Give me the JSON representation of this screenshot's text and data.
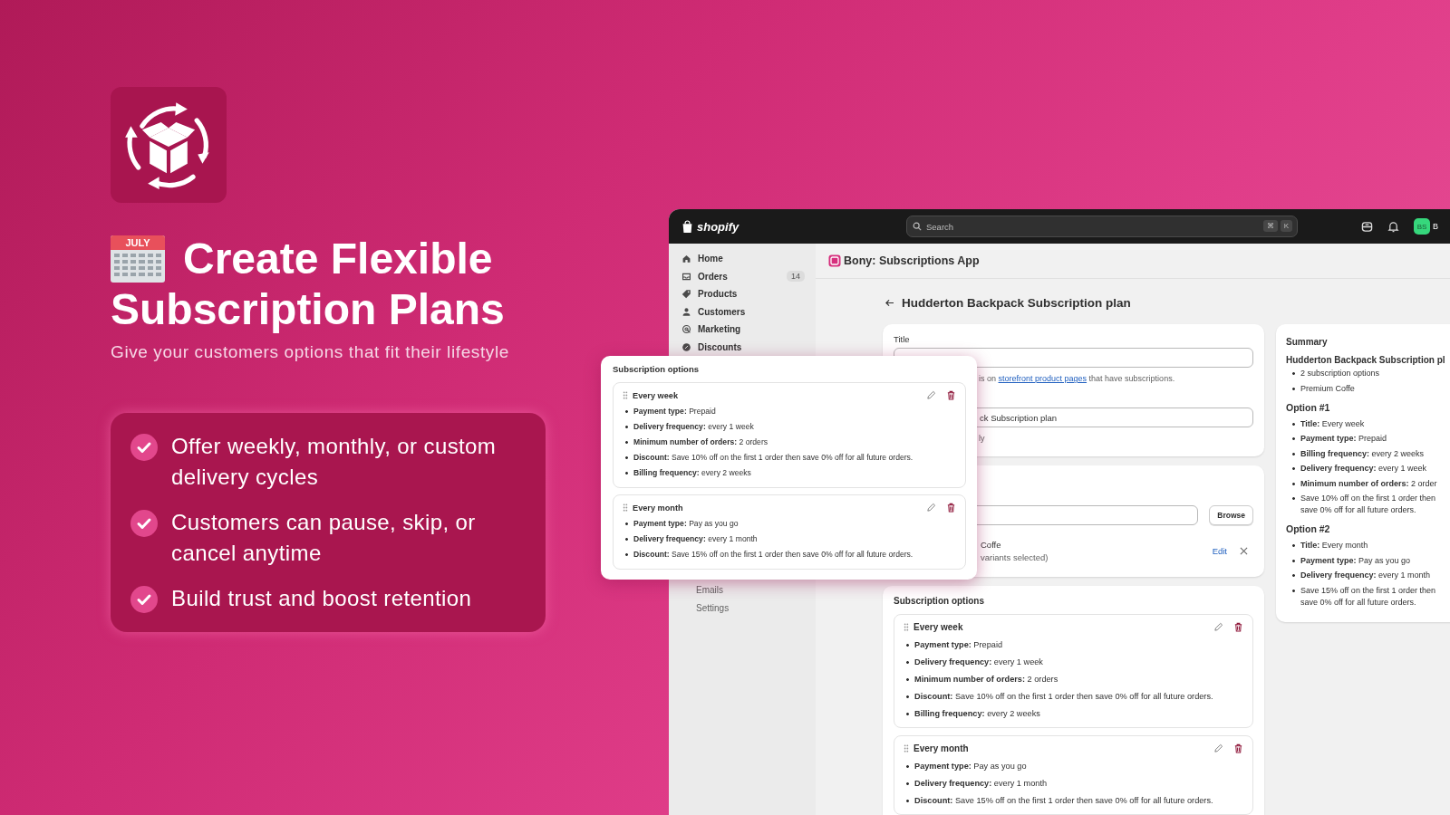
{
  "promo": {
    "calendar_label": "JULY",
    "heading_lines": [
      "Create Flexible",
      "Subscription Plans"
    ],
    "subtitle": "Give your customers options that fit their lifestyle",
    "features": [
      "Offer weekly, monthly, or custom delivery cycles",
      "Customers can pause, skip, or cancel anytime",
      "Build trust and boost retention"
    ]
  },
  "admin": {
    "brand": "shopify",
    "search": {
      "placeholder": "Search",
      "shortcut": [
        "⌘",
        "K"
      ]
    },
    "avatar": "BS",
    "user_name": "B",
    "sidebar": {
      "items": [
        {
          "label": "Home",
          "selected": false
        },
        {
          "label": "Orders",
          "badge": "14",
          "selected": false
        },
        {
          "label": "Products",
          "selected": false
        },
        {
          "label": "Customers",
          "selected": false
        },
        {
          "label": "Marketing",
          "selected": false
        },
        {
          "label": "Discounts",
          "selected": false
        }
      ],
      "lower_items": [
        {
          "label": "Emails",
          "selected": false
        },
        {
          "label": "Settings",
          "selected": false
        }
      ]
    },
    "app_title": "Bony: Subscriptions App",
    "page_title": "Hudderton Backpack Subscription plan",
    "title_card": {
      "label": "Title",
      "hint_before": "is on ",
      "hint_link": "storefront product pages",
      "hint_after": " that have subscriptions.",
      "name_value": "ck Subscription plan",
      "name_hint": "ly"
    },
    "product_card": {
      "browse": "Browse",
      "product_name": "Coffe",
      "product_detail": "variants selected)",
      "edit": "Edit"
    },
    "options_card": {
      "heading": "Subscription options",
      "options": [
        {
          "title": "Every week",
          "details": [
            "**Payment type:** Prepaid",
            "**Delivery frequency:** every 1 week",
            "**Minimum number of orders:** 2 orders",
            "**Discount:** Save 10% off on the first 1 order then save 0% off for all future orders.",
            "**Billing frequency:** every 2 weeks"
          ]
        },
        {
          "title": "Every month",
          "details": [
            "**Payment type:** Pay as you go",
            "**Delivery frequency:** every 1 month",
            "**Discount:** Save 15% off on the first 1 order then save 0% off for all future orders."
          ]
        }
      ]
    },
    "summary": {
      "heading": "Summary",
      "plan_name": "Hudderton Backpack Subscription pl",
      "overview": [
        "2 subscription options",
        "Premium Coffe"
      ],
      "options": [
        {
          "heading": "Option #1",
          "details": [
            "**Title:** Every week",
            "**Payment type:** Prepaid",
            "**Billing frequency:** every 2 weeks",
            "**Delivery frequency:** every 1 week",
            "**Minimum number of orders:** 2 order",
            "Save 10% off on the first 1 order then save 0% off for all future orders."
          ]
        },
        {
          "heading": "Option #2",
          "details": [
            "**Title:** Every month",
            "**Payment type:** Pay as you go",
            "**Delivery frequency:** every 1 month",
            "Save 15% off on the first 1 order then save 0% off for all future orders."
          ]
        }
      ]
    }
  },
  "popup": {
    "heading": "Subscription options",
    "options": [
      {
        "title": "Every week",
        "details": [
          "**Payment type:** Prepaid",
          "**Delivery frequency:** every 1 week",
          "**Minimum number of orders:** 2 orders",
          "**Discount:** Save 10% off on the first 1 order then save 0% off for all future orders.",
          "**Billing frequency:** every 2 weeks"
        ]
      },
      {
        "title": "Every month",
        "details": [
          "**Payment type:** Pay as you go",
          "**Delivery frequency:** every 1 month",
          "**Discount:** Save 15% off on the first 1 order then save 0% off for all future orders."
        ]
      }
    ]
  }
}
